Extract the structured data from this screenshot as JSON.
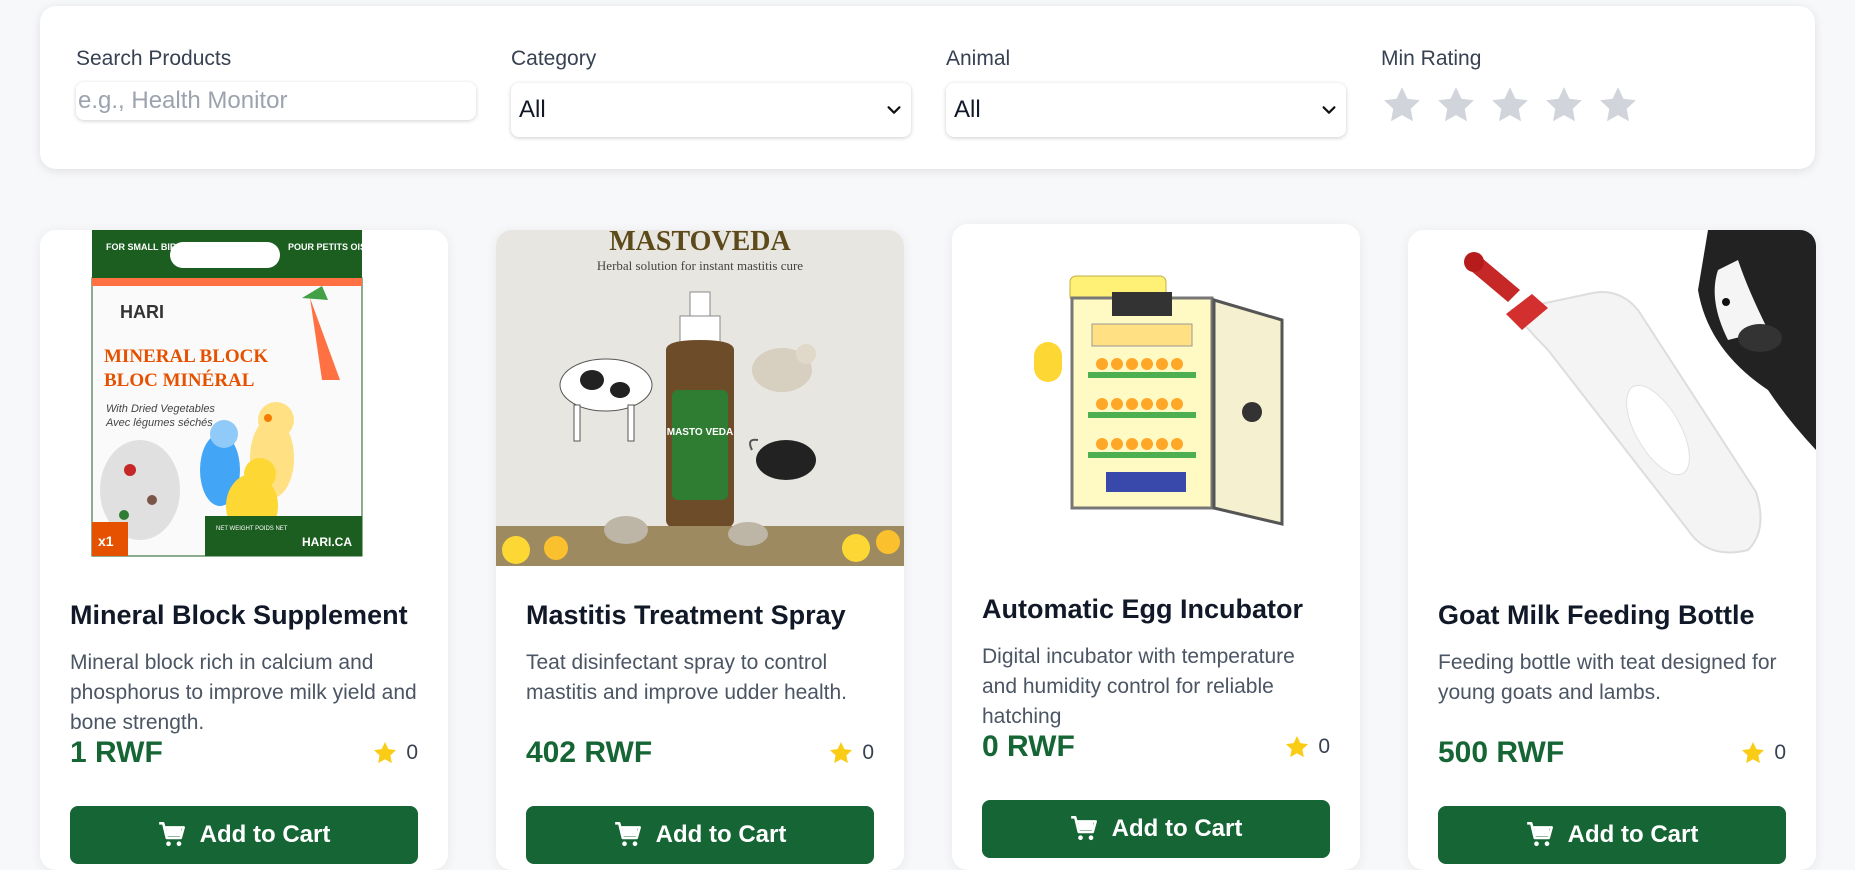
{
  "filters": {
    "search": {
      "label": "Search Products",
      "placeholder": "e.g., Health Monitor",
      "value": ""
    },
    "category": {
      "label": "Category",
      "value": "All"
    },
    "animal": {
      "label": "Animal",
      "value": "All"
    },
    "rating": {
      "label": "Min Rating",
      "value": 0,
      "max": 5
    }
  },
  "products": [
    {
      "title": "Mineral Block Supplement",
      "description": "Mineral block rich in calcium and phosphorus to improve milk yield and bone strength.",
      "price": "1 RWF",
      "rating": "0",
      "button": "Add to Cart",
      "image": {
        "icon": "mineral-block-package",
        "box_top_left": "FOR SMALL BIRDS",
        "box_top_right": "POUR PETITS OISEAUX",
        "brand": "HARI",
        "line1": "MINERAL BLOCK",
        "line2": "BLOC MINÉRAL",
        "sub1": "With Dried Vegetables",
        "sub2": "Avec légumes séchés",
        "qty": "x1",
        "site": "HARI.CA",
        "net_weight": "NET WEIGHT POIDS NET"
      }
    },
    {
      "title": "Mastitis Treatment Spray",
      "description": "Teat disinfectant spray to control mastitis and improve udder health.",
      "price": "402 RWF",
      "rating": "0",
      "button": "Add to Cart",
      "image": {
        "icon": "mastitis-spray-bottle",
        "heading": "MASTOVEDA",
        "tagline": "Herbal solution for instant mastitis cure",
        "bottle_label": "MASTO VEDA"
      }
    },
    {
      "title": "Automatic Egg Incubator",
      "description": "Digital incubator with temperature and humidity control for reliable hatching",
      "price": "0 RWF",
      "rating": "0",
      "button": "Add to Cart",
      "image": {
        "icon": "egg-incubator"
      }
    },
    {
      "title": "Goat Milk Feeding Bottle",
      "description": "Feeding bottle with teat designed for young goats and lambs.",
      "price": "500 RWF",
      "rating": "0",
      "button": "Add to Cart",
      "image": {
        "icon": "feeding-bottle-with-cow"
      }
    }
  ],
  "colors": {
    "primary": "#166534",
    "star_empty": "#d1d5db",
    "star_filled": "#facc15"
  }
}
